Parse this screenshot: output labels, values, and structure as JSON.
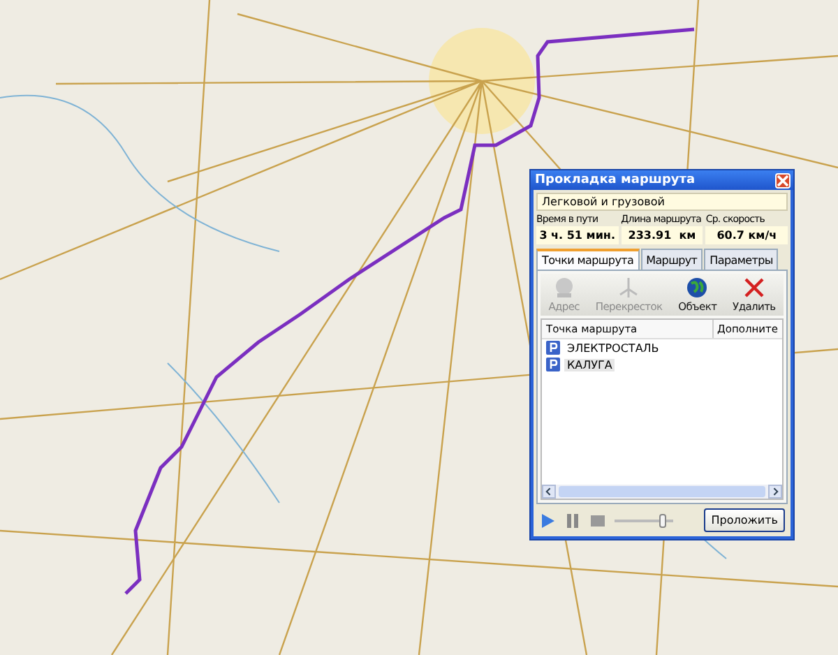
{
  "window": {
    "title": "Прокладка маршрута"
  },
  "vehicle_type": "Легковой и грузовой",
  "stats": [
    {
      "label": "Время в пути",
      "value": "3 ч. 51 мин."
    },
    {
      "label": "Длина маршрута",
      "value": "233.91  км"
    },
    {
      "label": "Ср. скорость",
      "value": "60.7 км/ч"
    }
  ],
  "tabs": [
    {
      "label": "Точки маршрута",
      "selected": true
    },
    {
      "label": "Маршрут",
      "selected": false
    },
    {
      "label": "Параметры",
      "selected": false
    }
  ],
  "toolbar": [
    {
      "label": "Адрес",
      "kind": "address",
      "disabled": true
    },
    {
      "label": "Перекресток",
      "kind": "crossing",
      "disabled": true
    },
    {
      "label": "Объект",
      "kind": "globe",
      "disabled": false
    },
    {
      "label": "Удалить",
      "kind": "delete",
      "disabled": false
    }
  ],
  "table": {
    "columns": [
      "Точка маршрута",
      "Дополните"
    ],
    "rows": [
      {
        "name": "ЭЛЕКТРОСТАЛЬ",
        "selected": false
      },
      {
        "name": "КАЛУГА",
        "selected": true
      }
    ]
  },
  "playback": {
    "level": 0.8
  },
  "buttons": [
    "Проложить"
  ]
}
